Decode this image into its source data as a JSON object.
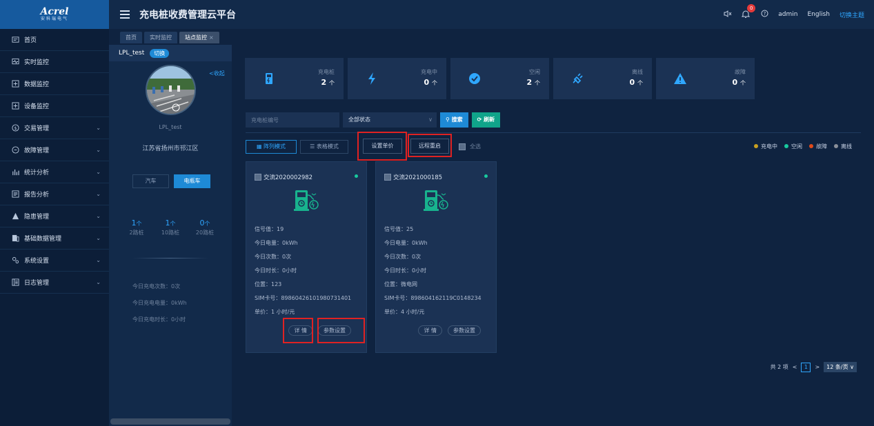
{
  "logo": {
    "brand": "Acrel",
    "sub": "安科瑞电气"
  },
  "header": {
    "title": "充电桩收费管理云平台",
    "notification_count": "0",
    "user": "admin",
    "language": "English",
    "theme_link": "切换主题"
  },
  "sidebar": {
    "items": [
      {
        "label": "首页",
        "icon": "home-icon",
        "has_children": false
      },
      {
        "label": "实时监控",
        "icon": "monitor-icon",
        "has_children": false
      },
      {
        "label": "数据监控",
        "icon": "data-icon",
        "has_children": false
      },
      {
        "label": "设备监控",
        "icon": "device-icon",
        "has_children": false
      },
      {
        "label": "交易管理",
        "icon": "transaction-icon",
        "has_children": true
      },
      {
        "label": "故障管理",
        "icon": "fault-icon",
        "has_children": true
      },
      {
        "label": "统计分析",
        "icon": "stats-icon",
        "has_children": true
      },
      {
        "label": "报告分析",
        "icon": "report-icon",
        "has_children": true
      },
      {
        "label": "隐患管理",
        "icon": "hazard-icon",
        "has_children": true
      },
      {
        "label": "基础数据管理",
        "icon": "basedata-icon",
        "has_children": true
      },
      {
        "label": "系统设置",
        "icon": "settings-icon",
        "has_children": true
      },
      {
        "label": "日志管理",
        "icon": "log-icon",
        "has_children": true
      }
    ]
  },
  "tabs": [
    {
      "label": "首页",
      "active": false,
      "closable": false
    },
    {
      "label": "实时监控",
      "active": false,
      "closable": false
    },
    {
      "label": "站点监控",
      "active": true,
      "closable": true
    }
  ],
  "station": {
    "name_top": "LPL_test",
    "switch_label": "切换",
    "collapse_label": "<收起",
    "name": "LPL_test",
    "address": "江苏省扬州市邗江区",
    "vehicle_car": "汽车",
    "vehicle_ebike": "电瓶车",
    "unit": "个",
    "port_stats": [
      {
        "value": "1",
        "label": "2路桩"
      },
      {
        "value": "1",
        "label": "10路桩"
      },
      {
        "value": "0",
        "label": "20路桩"
      }
    ],
    "today_charge_count": "今日充电次数：0次",
    "today_charge_energy": "今日充电电量：0kWh",
    "today_charge_duration": "今日充电时长：0小时"
  },
  "stats": [
    {
      "label": "充电桩",
      "value": "2",
      "unit": "个",
      "icon": "charging-pile-icon"
    },
    {
      "label": "充电中",
      "value": "0",
      "unit": "个",
      "icon": "lightning-icon"
    },
    {
      "label": "空闲",
      "value": "2",
      "unit": "个",
      "icon": "check-circle-icon"
    },
    {
      "label": "离线",
      "value": "0",
      "unit": "个",
      "icon": "unplugged-icon"
    },
    {
      "label": "故障",
      "value": "0",
      "unit": "个",
      "icon": "warning-icon"
    }
  ],
  "filter": {
    "pile_placeholder": "充电桩编号",
    "status_value": "全部状态",
    "search_label": "搜索",
    "refresh_label": "刷新"
  },
  "toolbar": {
    "grid_mode": "阵列模式",
    "table_mode": "表格模式",
    "set_price": "设置单价",
    "remote_reboot": "远程重启",
    "select_all": "全选"
  },
  "legend": [
    {
      "label": "充电中",
      "color": "#c8a020"
    },
    {
      "label": "空闲",
      "color": "#18c99e"
    },
    {
      "label": "故障",
      "color": "#e04a1a"
    },
    {
      "label": "离线",
      "color": "#8a8f99"
    }
  ],
  "cards": [
    {
      "name": "交流2020002982",
      "status_color": "#18c99e",
      "signal": "信号值：19",
      "energy": "今日电量：0kWh",
      "count": "今日次数：0次",
      "duration": "今日时长：0小时",
      "location": "位置：123",
      "sim": "SIM卡号：89860426101980731401",
      "price": "单价：1 小时/元",
      "detail_label": "详 情",
      "params_label": "参数设置"
    },
    {
      "name": "交流2021000185",
      "status_color": "#18c99e",
      "signal": "信号值：25",
      "energy": "今日电量：0kWh",
      "count": "今日次数：0次",
      "duration": "今日时长：0小时",
      "location": "位置：微电网",
      "sim": "SIM卡号：898604162119C0148234",
      "price": "单价：4 小时/元",
      "detail_label": "详 情",
      "params_label": "参数设置"
    }
  ],
  "pagination": {
    "total": "共 2 项",
    "current_page": "1",
    "page_size": "12 条/页"
  },
  "colors": {
    "accent": "#1e8ad6",
    "refresh": "#10a48a",
    "highlight_box": "#e02222",
    "sidebar_logo_bg": "#165a9e"
  }
}
